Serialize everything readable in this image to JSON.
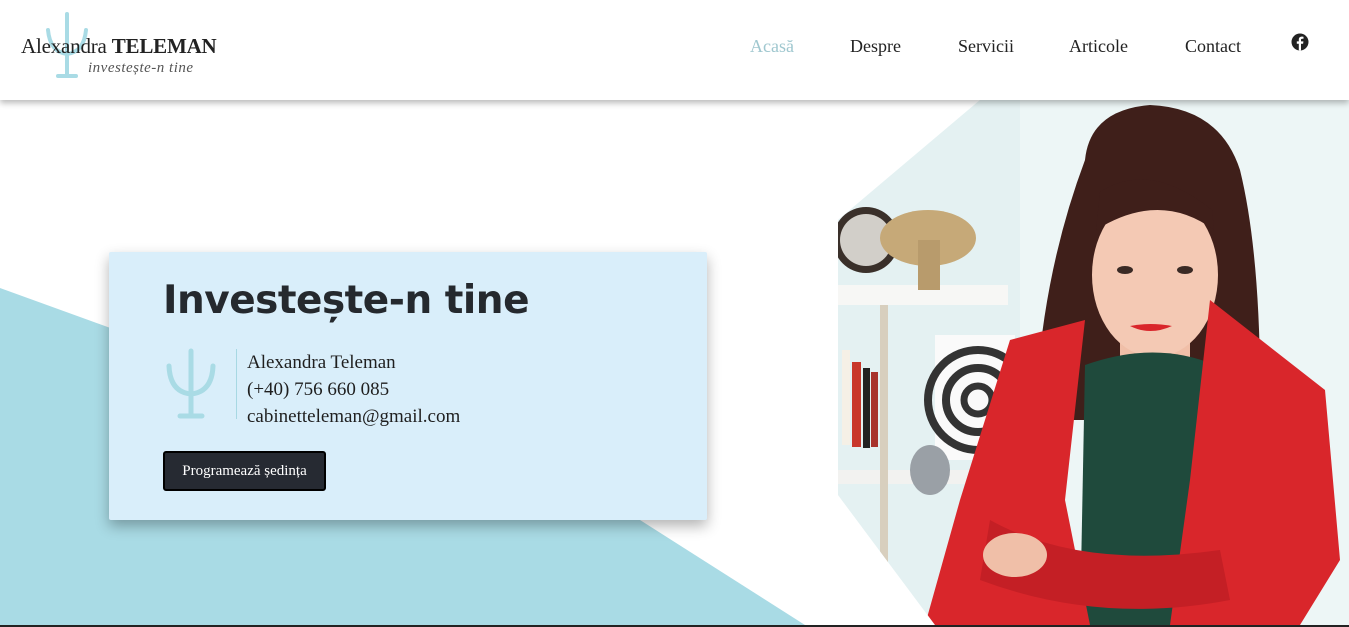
{
  "header": {
    "logo": {
      "name_regular": "Alexandra",
      "name_bold": "TELEMAN",
      "tagline": "investește-n tine"
    },
    "nav": [
      {
        "label": "Acasă",
        "active": true
      },
      {
        "label": "Despre",
        "active": false
      },
      {
        "label": "Servicii",
        "active": false
      },
      {
        "label": "Articole",
        "active": false
      },
      {
        "label": "Contact",
        "active": false
      }
    ],
    "social_icon": "facebook-icon"
  },
  "hero": {
    "title": "Investește-n tine",
    "contact": {
      "name": "Alexandra Teleman",
      "phone": "(+40) 756 660 085",
      "email": "cabinetteleman@gmail.com"
    },
    "cta_label": "Programează ședința"
  },
  "colors": {
    "accent": "#a9dbe5",
    "card_bg": "#d9eefa",
    "nav_active": "#9fc7cf",
    "button_bg": "#262a32",
    "jacket_red": "#d9262b"
  }
}
